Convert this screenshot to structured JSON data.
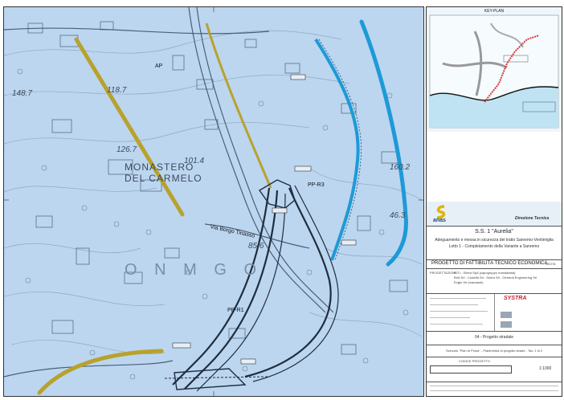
{
  "map": {
    "labels": {
      "ap": "AP",
      "pp_r3": "PP-R3",
      "pp_r1": "PP-R1",
      "monastero": "MONASTERO",
      "carmelo": "DEL CARMELO",
      "road": "Via Borgo Tinasso",
      "ghost_text": "O N M G O",
      "e1": "148.7",
      "e2": "118.7",
      "e3": "126.7",
      "e4": "101.4",
      "e5": "160.2",
      "e6": "46.3",
      "e7": "85.6"
    },
    "colors": {
      "background": "#bcd6f0",
      "yellow_line": "#b8a22c",
      "blue_alignment": "#1e9ad6",
      "dark_alignment": "#1f2d3d"
    }
  },
  "keyplan": {
    "title": "KEY-PLAN"
  },
  "titleblock": {
    "brand": "anas",
    "direzione": "Direzione Tecnica",
    "road_name": "S.S. 1 \"Aurelia\"",
    "desc_1": "Adeguamento e messa in sicurezza del tratto Sanremo-Ventimiglia",
    "desc_2": "Lotto 1 - Completamento della Variante a Sanremo",
    "phase": "PROGETTO DI FATTIBILITÀ TECNICO ECONOMICA",
    "code": "GE278",
    "progettazione_label": "PROGETTAZIONE:",
    "progettazione_1": "R.T.I.: Sintra SpA (capogruppo mandataria)",
    "progettazione_2": "BVA Srl - Codelfa Srl - Sintra Srl - General Engineering Srl",
    "progettazione_3": "Engin Srl (mandanti)",
    "systra": "SYSTRA",
    "section": "04 - Progetto stradale",
    "subsection": "Svincolo \"Pian di Poma\" - Planimetria di progetto strade - Tav. 1 di 2",
    "code_label": "CODICE PROGETTO",
    "scale": "1:1000"
  }
}
